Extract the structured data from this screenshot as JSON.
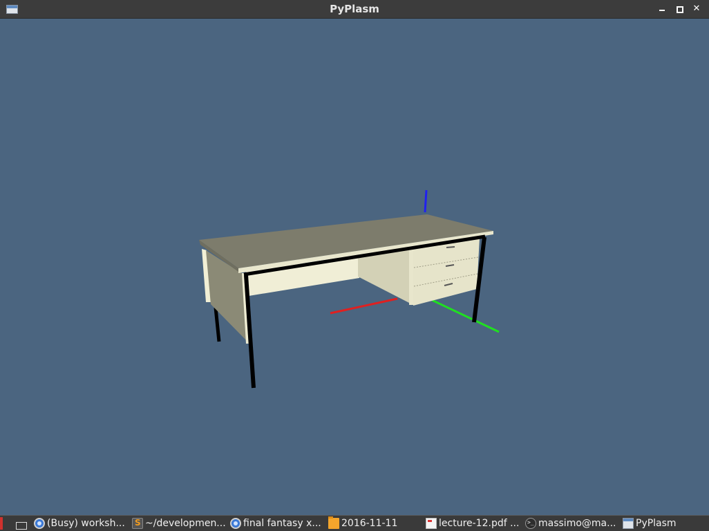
{
  "window": {
    "title": "PyPlasm"
  },
  "scene": {
    "background_color": "#4b6580",
    "axis_colors": {
      "x": "#e02020",
      "y": "#20e020",
      "z": "#2020f0"
    },
    "desk_top_color": "#7d7c6c",
    "desk_panel_color": "#efedd4",
    "leg_color": "#000000"
  },
  "taskbar": {
    "items": [
      {
        "label": "(Busy) worksh...",
        "icon": "chrome-icon"
      },
      {
        "label": "~/developmen...",
        "icon": "sublime-text-icon"
      },
      {
        "label": "final fantasy x...",
        "icon": "chrome-icon"
      },
      {
        "label": "2016-11-11",
        "icon": "folder-icon"
      },
      {
        "label": "lecture-12.pdf ...",
        "icon": "pdf-document-icon"
      },
      {
        "label": "massimo@ma...",
        "icon": "terminal-icon"
      },
      {
        "label": "PyPlasm",
        "icon": "window-icon"
      }
    ]
  }
}
